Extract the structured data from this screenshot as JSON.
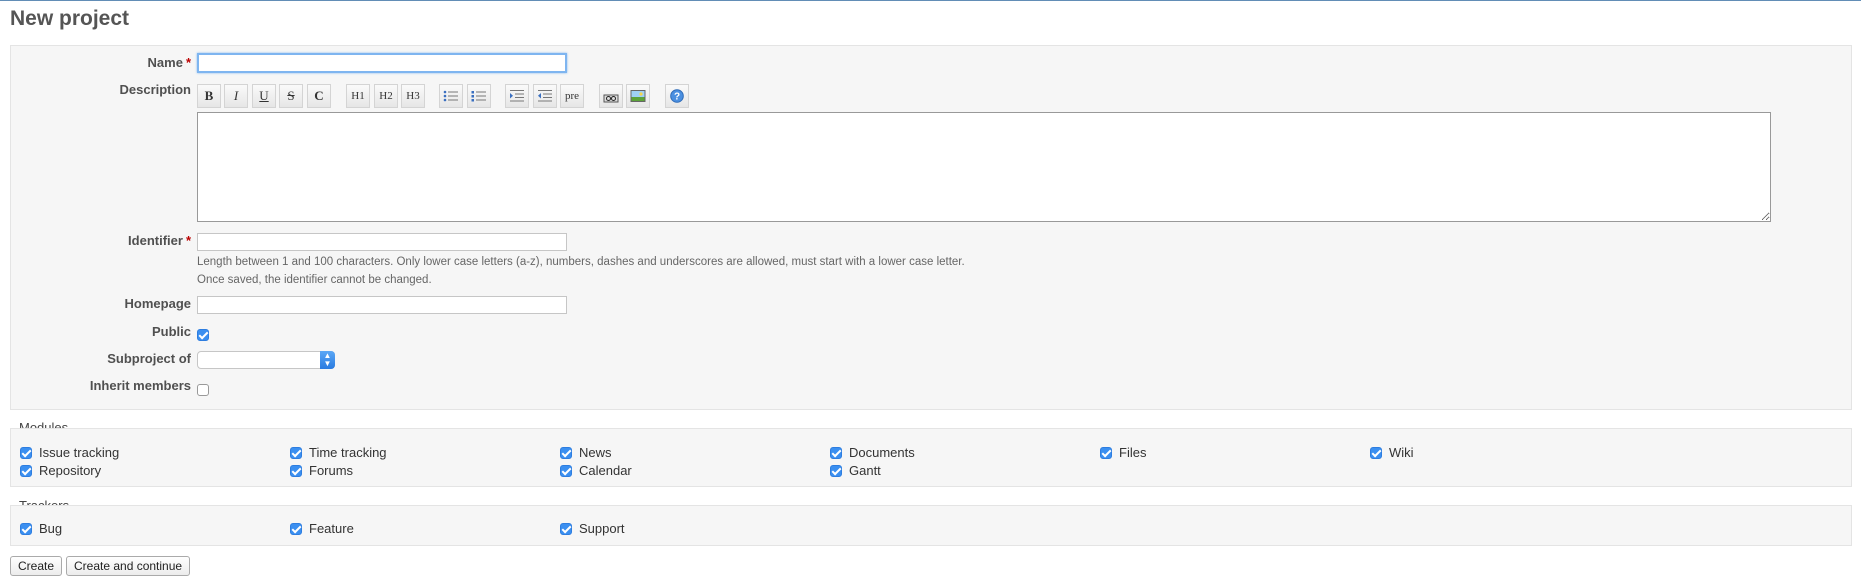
{
  "page": {
    "title": "New project"
  },
  "form": {
    "name_label": "Name",
    "required_mark": "*",
    "description_label": "Description",
    "identifier_label": "Identifier",
    "identifier_help_1": "Length between 1 and 100 characters. Only lower case letters (a-z), numbers, dashes and underscores are allowed, must start with a lower case letter.",
    "identifier_help_2": "Once saved, the identifier cannot be changed.",
    "homepage_label": "Homepage",
    "public_label": "Public",
    "public_checked": true,
    "subproject_label": "Subproject of",
    "subproject_value": "",
    "inherit_label": "Inherit members",
    "inherit_checked": false
  },
  "toolbar": {
    "bold": "B",
    "italic": "I",
    "underline": "U",
    "strike": "S",
    "code": "C",
    "h1": "H1",
    "h2": "H2",
    "h3": "H3",
    "pre": "pre"
  },
  "modules": {
    "legend": "Modules",
    "items": [
      {
        "label": "Issue tracking",
        "checked": true
      },
      {
        "label": "Time tracking",
        "checked": true
      },
      {
        "label": "News",
        "checked": true
      },
      {
        "label": "Documents",
        "checked": true
      },
      {
        "label": "Files",
        "checked": true
      },
      {
        "label": "Wiki",
        "checked": true
      },
      {
        "label": "Repository",
        "checked": true
      },
      {
        "label": "Forums",
        "checked": true
      },
      {
        "label": "Calendar",
        "checked": true
      },
      {
        "label": "Gantt",
        "checked": true
      }
    ]
  },
  "trackers": {
    "legend": "Trackers",
    "items": [
      {
        "label": "Bug",
        "checked": true
      },
      {
        "label": "Feature",
        "checked": true
      },
      {
        "label": "Support",
        "checked": true
      }
    ]
  },
  "actions": {
    "create": "Create",
    "create_continue": "Create and continue"
  },
  "colors": {
    "required": "#bb0000",
    "checkbox": "#3b8ff0",
    "focus": "#7eb5f0",
    "header_rule": "#628db6"
  }
}
